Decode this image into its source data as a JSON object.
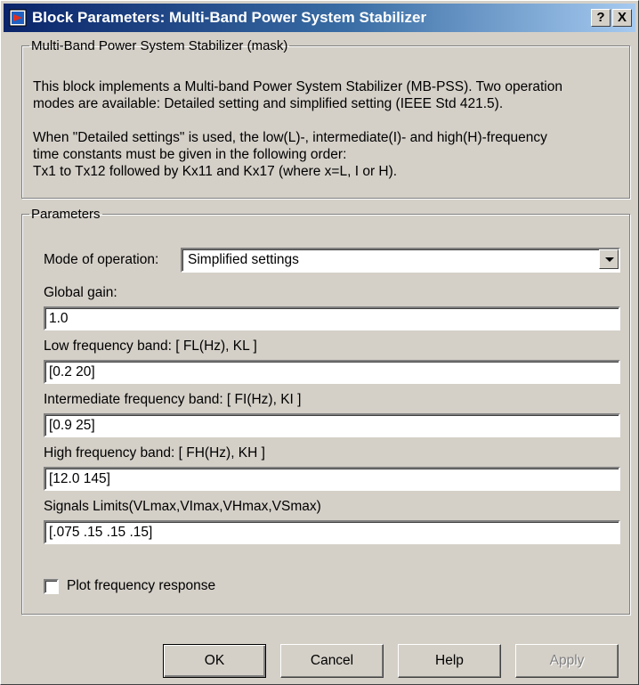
{
  "window": {
    "title": "Block Parameters: Multi-Band Power System Stabilizer",
    "help_button": "?",
    "close_button": "X"
  },
  "mask": {
    "legend": "Multi-Band Power System Stabilizer  (mask)",
    "paragraph1_line1": "This block implements a Multi-band Power System Stabilizer (MB-PSS). Two operation",
    "paragraph1_line2": "modes are available: Detailed setting and simplified setting (IEEE Std 421.5).",
    "paragraph2_line1": "When \"Detailed settings\" is used, the low(L)-, intermediate(I)- and high(H)-frequency",
    "paragraph2_line2": "time constants must be given in the following order:",
    "paragraph2_line3": "Tx1 to Tx12 followed by Kx11 and Kx17 (where x=L, I or H)."
  },
  "parameters": {
    "legend": "Parameters",
    "mode_label": "Mode of operation:",
    "mode_value": "Simplified settings",
    "global_gain_label": "Global gain:",
    "global_gain_value": "1.0",
    "low_band_label": "Low frequency band: [ FL(Hz), KL ]",
    "low_band_value": "[0.2 20]",
    "intermediate_band_label": "Intermediate frequency band: [ FI(Hz), KI ]",
    "intermediate_band_value": "[0.9 25]",
    "high_band_label": "High frequency band: [ FH(Hz), KH ]",
    "high_band_value": "[12.0 145]",
    "limits_label": "Signals Limits(VLmax,VImax,VHmax,VSmax)",
    "limits_value": "[.075 .15 .15 .15]",
    "plot_checkbox_label": "Plot frequency response",
    "plot_checked": false
  },
  "buttons": {
    "ok": "OK",
    "cancel": "Cancel",
    "help": "Help",
    "apply": "Apply"
  },
  "colors": {
    "dialog_bg": "#d4d0c8",
    "titlebar_start": "#0a246a",
    "titlebar_end": "#a6caf0"
  }
}
